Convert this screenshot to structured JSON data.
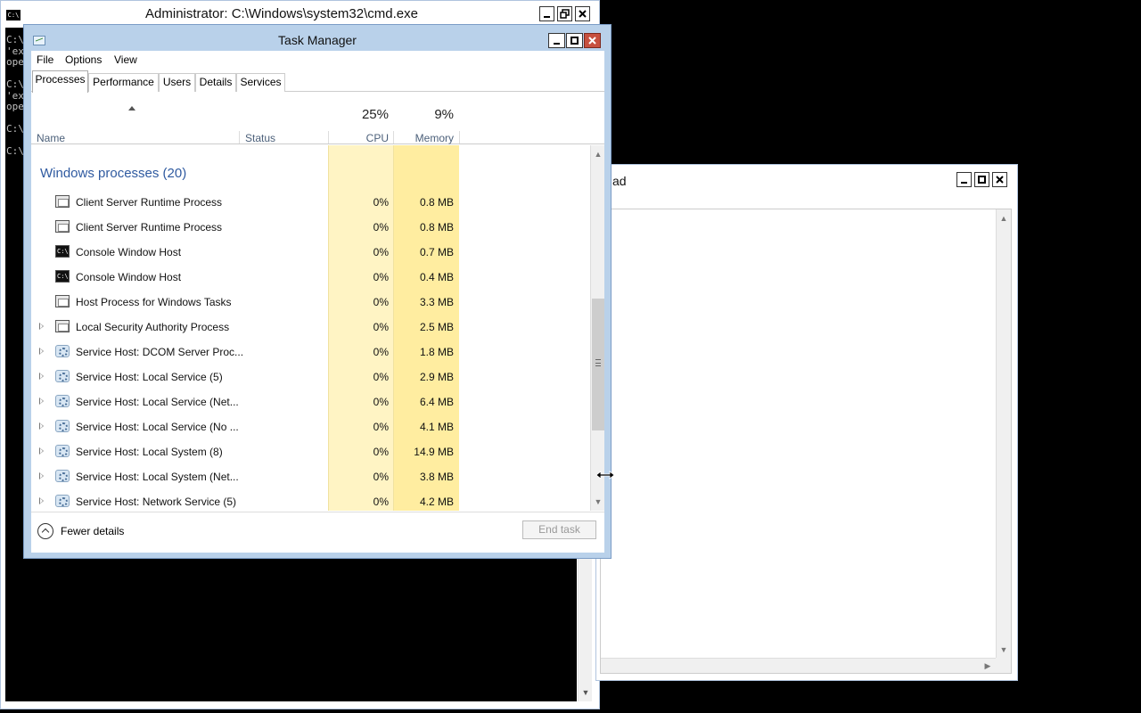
{
  "cmd": {
    "title": "Administrator: C:\\Windows\\system32\\cmd.exe",
    "icon_text": "C:\\",
    "console_lines": [
      "C:\\",
      "'ex",
      "ope",
      "",
      "C:\\",
      "'ex",
      "ope",
      "",
      "C:\\",
      "",
      "C:\\"
    ]
  },
  "notepad": {
    "title_fragment": "ad"
  },
  "taskmanager": {
    "title": "Task Manager",
    "menu": [
      "File",
      "Options",
      "View"
    ],
    "tabs": [
      "Processes",
      "Performance",
      "Users",
      "Details",
      "Services"
    ],
    "active_tab": "Processes",
    "columns": {
      "name": "Name",
      "status": "Status",
      "cpu_label": "CPU",
      "cpu_total": "25%",
      "memory_label": "Memory",
      "memory_total": "9%"
    },
    "group": {
      "title": "Windows processes (20)"
    },
    "processes": [
      {
        "name": "Client Server Runtime Process",
        "cpu": "0%",
        "memory": "0.8 MB",
        "icon": "window-icon",
        "expandable": false
      },
      {
        "name": "Client Server Runtime Process",
        "cpu": "0%",
        "memory": "0.8 MB",
        "icon": "window-icon",
        "expandable": false
      },
      {
        "name": "Console Window Host",
        "cpu": "0%",
        "memory": "0.7 MB",
        "icon": "console-icon",
        "expandable": false
      },
      {
        "name": "Console Window Host",
        "cpu": "0%",
        "memory": "0.4 MB",
        "icon": "console-icon",
        "expandable": false
      },
      {
        "name": "Host Process for Windows Tasks",
        "cpu": "0%",
        "memory": "3.3 MB",
        "icon": "window-icon",
        "expandable": false
      },
      {
        "name": "Local Security Authority Process",
        "cpu": "0%",
        "memory": "2.5 MB",
        "icon": "window-icon",
        "expandable": true
      },
      {
        "name": "Service Host: DCOM Server Proc...",
        "cpu": "0%",
        "memory": "1.8 MB",
        "icon": "gear-icon",
        "expandable": true
      },
      {
        "name": "Service Host: Local Service (5)",
        "cpu": "0%",
        "memory": "2.9 MB",
        "icon": "gear-icon",
        "expandable": true
      },
      {
        "name": "Service Host: Local Service (Net...",
        "cpu": "0%",
        "memory": "6.4 MB",
        "icon": "gear-icon",
        "expandable": true
      },
      {
        "name": "Service Host: Local Service (No ...",
        "cpu": "0%",
        "memory": "4.1 MB",
        "icon": "gear-icon",
        "expandable": true
      },
      {
        "name": "Service Host: Local System (8)",
        "cpu": "0%",
        "memory": "14.9 MB",
        "icon": "gear-icon",
        "expandable": true
      },
      {
        "name": "Service Host: Local System (Net...",
        "cpu": "0%",
        "memory": "3.8 MB",
        "icon": "gear-icon",
        "expandable": true
      },
      {
        "name": "Service Host: Network Service (5)",
        "cpu": "0%",
        "memory": "4.2 MB",
        "icon": "gear-icon",
        "expandable": true
      }
    ],
    "footer": {
      "fewer_details": "Fewer details",
      "end_task": "End task"
    }
  }
}
